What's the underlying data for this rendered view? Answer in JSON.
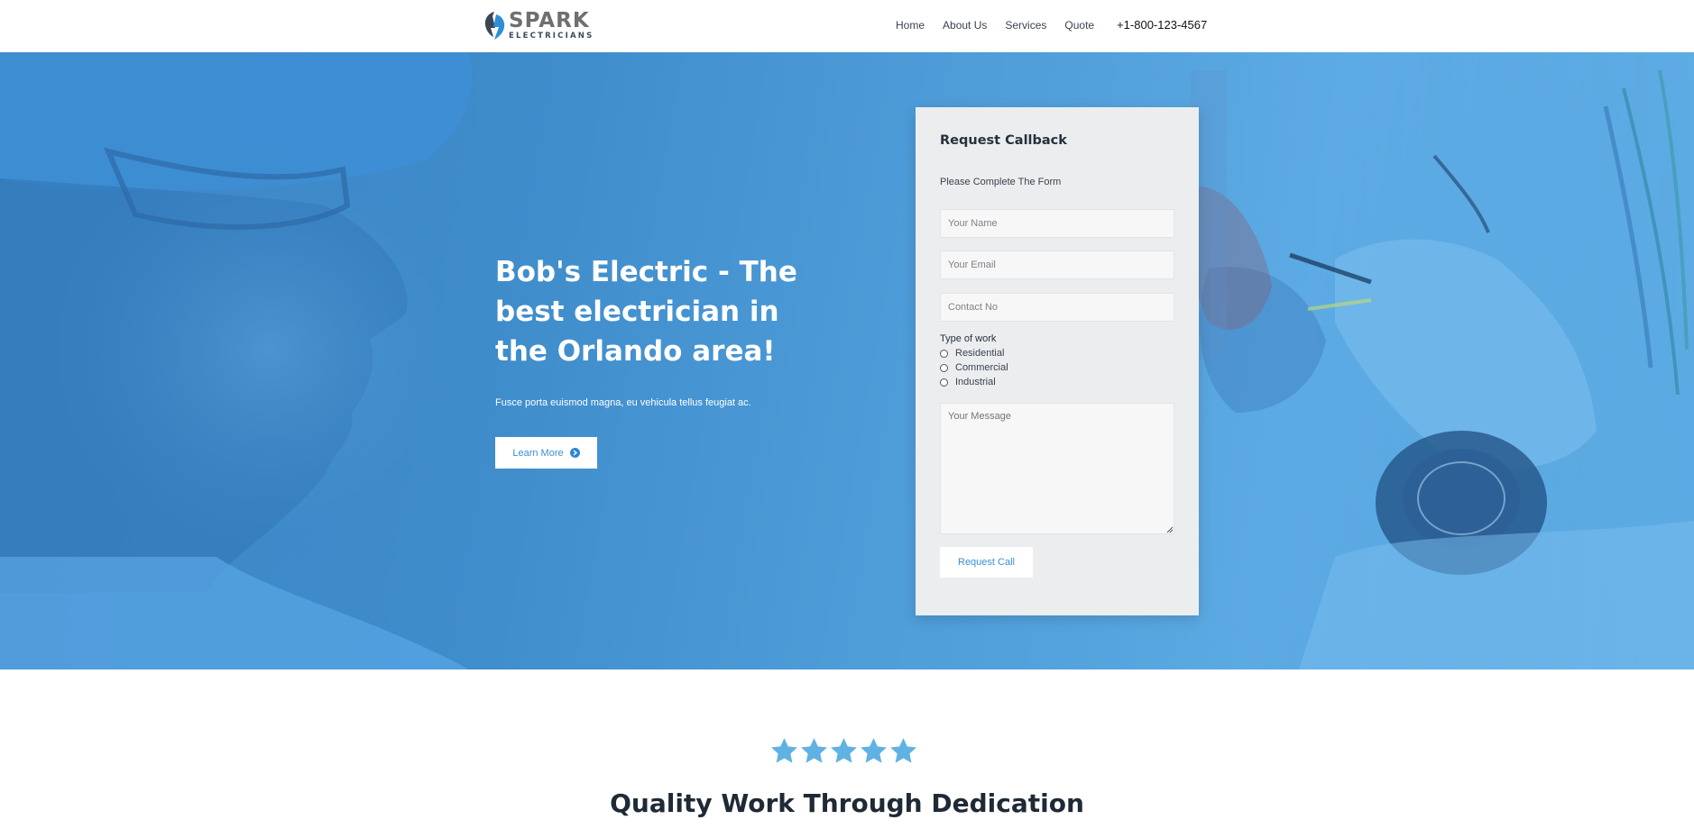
{
  "header": {
    "logo_word": "SPARK",
    "logo_sub": "ELECTRICIANS",
    "logo_icon": "lightning-bolt-icon",
    "nav": [
      "Home",
      "About Us",
      "Services",
      "Quote"
    ],
    "phone": "+1-800-123-4567"
  },
  "hero": {
    "headline": "Bob's Electric - The best electrician in the Orlando area!",
    "subtext": "Fusce porta euismod magna, eu vehicula tellus feugiat ac.",
    "cta_label": "Learn More",
    "cta_icon": "arrow-circle-right-icon"
  },
  "form": {
    "title": "Request Callback",
    "subtitle": "Please Complete The Form",
    "name_placeholder": "Your Name",
    "email_placeholder": "Your Email",
    "contact_placeholder": "Contact No",
    "type_label": "Type of work",
    "options": [
      "Residential",
      "Commercial",
      "Industrial"
    ],
    "message_placeholder": "Your Message",
    "submit_label": "Request Call"
  },
  "quality": {
    "stars": 5,
    "star_icon": "star-icon",
    "title": "Quality Work Through Dedication"
  },
  "colors": {
    "hero_blue": "#4f9dd9",
    "star_blue": "#5fb2e2",
    "accent": "#3b8fd4"
  }
}
